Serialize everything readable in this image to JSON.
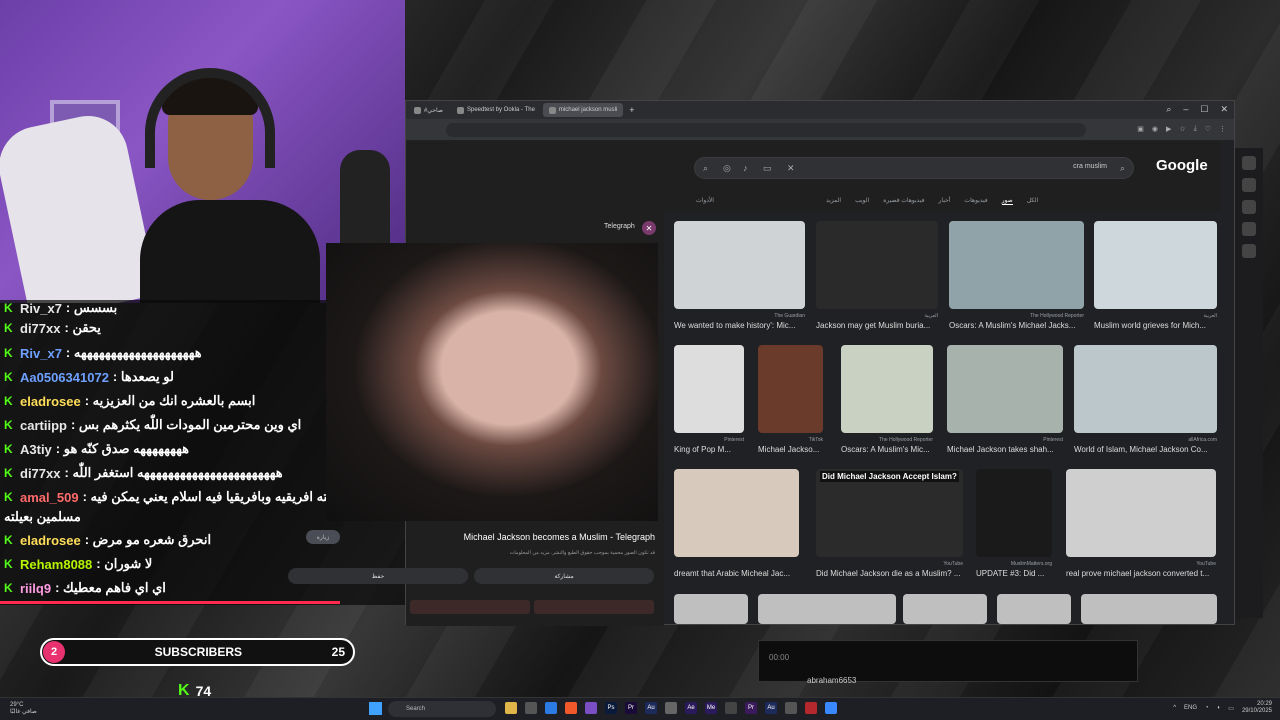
{
  "chat": {
    "messages": [
      {
        "user": "Riv_x7",
        "text": ": بسسس",
        "color": "w",
        "top": 0
      },
      {
        "user": "di77xx",
        "text": ": يحقن",
        "color": "w"
      },
      {
        "user": "Riv_x7",
        "text": ": ههههههههههههههههههههه",
        "color": "b"
      },
      {
        "user": "Aa0506341072",
        "text": ": لو يصعدها",
        "color": "b"
      },
      {
        "user": "eladrosee",
        "text": ": ابسم بالعشره انك من العزيزيه",
        "color": "y"
      },
      {
        "user": "cartiipp",
        "text": ": اي وين محترمين المودات اللّٰه يكثرهم بس",
        "color": "w"
      },
      {
        "user": "A3tiy",
        "text": ": ههههههههه صدق كنّه هو",
        "color": "w"
      },
      {
        "user": "di77xx",
        "text": ": هههههههههههههههههههههههه استغفر اللّٰه",
        "color": "w"
      },
      {
        "user": "amal_509",
        "text": ": مايكل عائلته افريقيه وبافريقيا فيه اسلام يعني يمكن فيه",
        "color": "r"
      },
      {
        "user": "",
        "text": "مسلمين بعيلته",
        "color": "w"
      },
      {
        "user": "eladrosee",
        "text": ": انحرق شعره مو مرض",
        "color": "y"
      },
      {
        "user": "Reham8088",
        "text": ": لا شوران",
        "color": "g"
      },
      {
        "user": "riilq9",
        "text": ": اي اي فاهم معطيك",
        "color": "p"
      }
    ]
  },
  "subscribers": {
    "badge": "2",
    "label": "SUBSCRIBERS",
    "goal": "25"
  },
  "kick_count": "74",
  "browser": {
    "tabs": [
      {
        "label": "#صاحي",
        "active": false
      },
      {
        "label": "Speedtest by Ookla - The",
        "active": false
      },
      {
        "label": "michael jackson musli",
        "active": true
      }
    ],
    "search_query": "cra muslim",
    "google_logo": "Google",
    "google_tabs": [
      "الكل",
      "صور",
      "فيديوهات",
      "أخبار",
      "فيديوهات قصيرة",
      "الويب",
      "المزيد"
    ],
    "active_tab": "صور",
    "tools_label": "الأدوات",
    "preview": {
      "source": "Telegraph",
      "title": "Michael Jackson becomes a Muslim - Telegraph",
      "subtitle": "قد تكون الصور محمية بموجب حقوق الطبع والنشر. مزيد من المعلومات",
      "share_label": "مشاركة",
      "save_label": "حفظ",
      "visit_label": "زيارة"
    },
    "results": [
      {
        "source": "The Guardian",
        "caption": "We wanted to make history': Mic..."
      },
      {
        "source": "العربية",
        "caption": "Jackson may get Muslim buria..."
      },
      {
        "source": "The Hollywood Reporter",
        "caption": "Oscars: A Muslim's Michael Jacks..."
      },
      {
        "source": "العربية",
        "caption": "Muslim world grieves for Mich..."
      },
      {
        "source": "Pinterest",
        "caption": "King of Pop M..."
      },
      {
        "source": "TikTok",
        "caption": "Michael Jackso..."
      },
      {
        "source": "The Hollywood Reporter",
        "caption": "Oscars: A Muslim's Mic..."
      },
      {
        "source": "Pinterest",
        "caption": "Michael Jackson takes shah..."
      },
      {
        "source": "allAfrica.com",
        "caption": "World of Islam, Michael Jackson Co..."
      },
      {
        "source": "",
        "caption": "dreamt that Arabic Micheal Jac..."
      },
      {
        "source": "YouTube",
        "caption": "Did Michael Jackson die as a Muslim? ..."
      },
      {
        "source": "MuslimMatters.org",
        "caption": "UPDATE #3: Did ..."
      },
      {
        "source": "YouTube",
        "caption": "real prove michael jackson converted t..."
      }
    ],
    "overlay_text": "Did Michael Jackson Accept Islam?"
  },
  "mini_player": {
    "time": "00:00",
    "user": "abraham6653"
  },
  "taskbar": {
    "weather_temp": "29°C",
    "weather_desc": "صافي غالبًا",
    "search_placeholder": "Search",
    "lang": "ENG",
    "time": "20:29",
    "date": "29/10/2025"
  },
  "colors": {
    "kick_green": "#53fc18",
    "accent_red": "#ff2a4e",
    "badge_pink": "#e8326f"
  }
}
